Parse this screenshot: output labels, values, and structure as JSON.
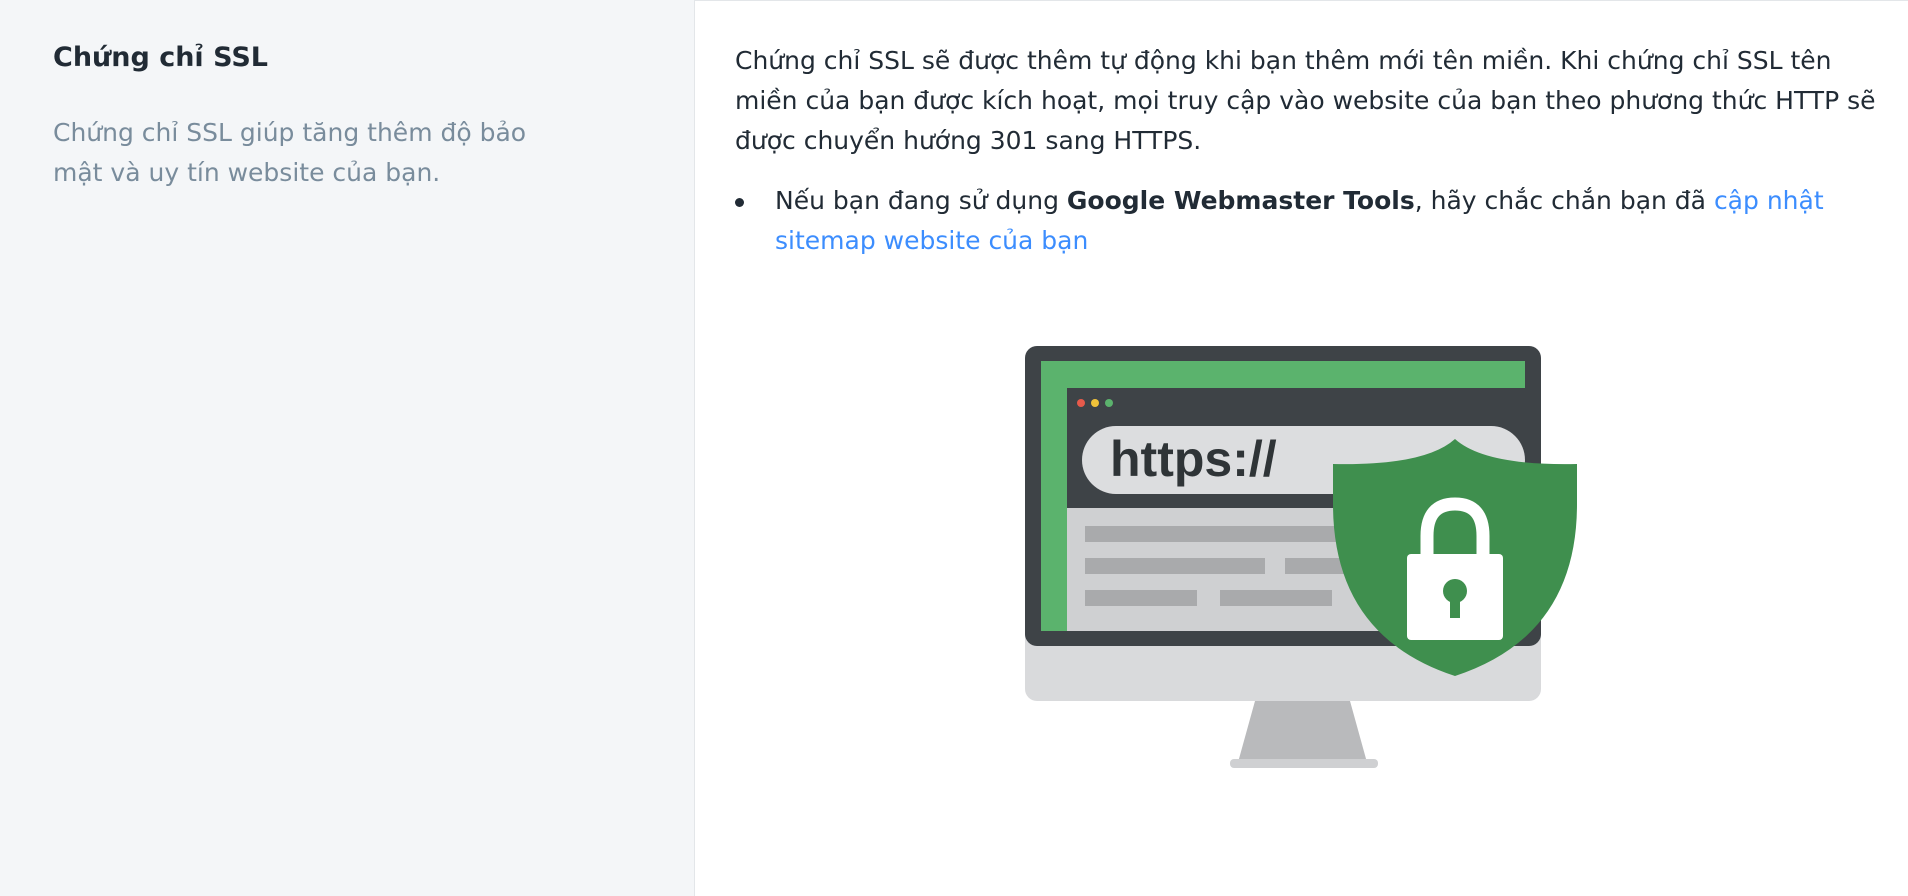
{
  "section": {
    "title": "Chứng chỉ SSL",
    "description": "Chứng chỉ SSL giúp tăng thêm độ bảo mật và uy tín website của bạn."
  },
  "card": {
    "paragraph": "Chứng chỉ SSL sẽ được thêm tự động khi bạn thêm mới tên miền. Khi chứng chỉ SSL tên miền của bạn được kích hoạt, mọi truy cập vào website của bạn theo phương thức HTTP sẽ được chuyển hướng 301 sang HTTPS.",
    "bullet": {
      "prefix": "Nếu bạn đang sử dụng ",
      "strong": "Google Webmaster Tools",
      "middle": ", hãy chắc chắn bạn đã ",
      "link": "cập nhật sitemap website của bạn"
    }
  },
  "illustration": {
    "url_text": "https://",
    "icon": "ssl-monitor-shield-lock-illustration",
    "colors": {
      "screen_frame": "#3e4347",
      "screen_green": "#5bb36d",
      "shield_green": "#3f8f4e",
      "monitor_base": "#d9dadc",
      "stand": "#b9babc"
    }
  }
}
